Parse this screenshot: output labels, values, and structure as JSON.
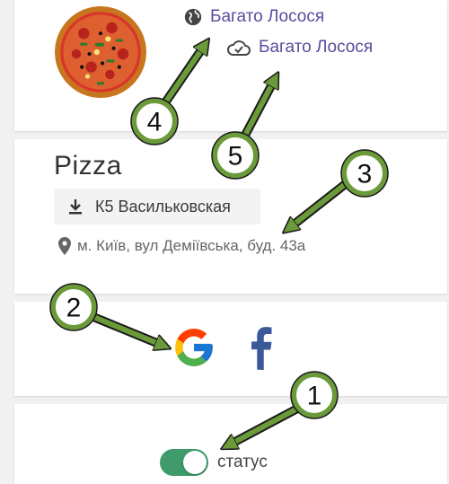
{
  "restaurant": {
    "name": "Pizza",
    "links": [
      {
        "label": "Багато Лосося",
        "icon": "globe-icon"
      },
      {
        "label": "Багато Лосося",
        "icon": "cloud-check-icon"
      }
    ],
    "branch": {
      "label": "К5 Васильковская",
      "icon": "download-icon"
    },
    "address": {
      "label": "м. Київ, вул Деміївська, буд. 43а",
      "icon": "location-pin-icon"
    }
  },
  "social": [
    {
      "name": "google",
      "icon": "google-logo-icon"
    },
    {
      "name": "facebook",
      "icon": "facebook-logo-icon"
    }
  ],
  "status": {
    "label": "статус",
    "enabled": true
  },
  "annotations": [
    "1",
    "2",
    "3",
    "4",
    "5"
  ],
  "colors": {
    "accent_link": "#5a4b9e",
    "toggle_on": "#3f9b6c",
    "annotation_green": "#6a9a3a"
  }
}
